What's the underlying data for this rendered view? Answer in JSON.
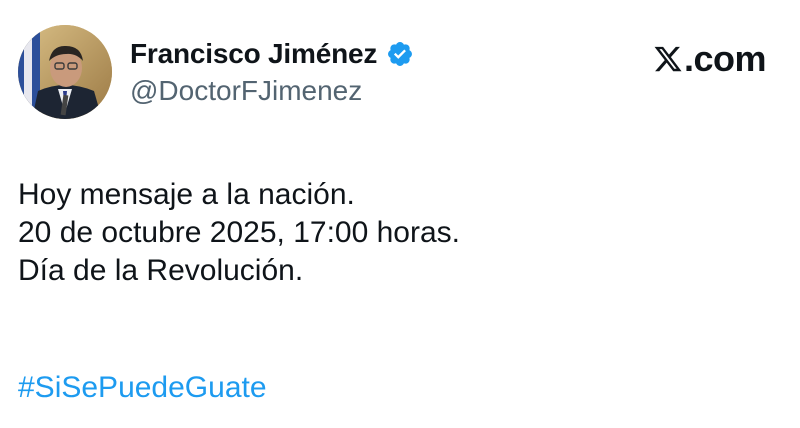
{
  "author": {
    "display_name": "Francisco Jiménez",
    "handle": "@DoctorFJimenez",
    "verified_badge_icon": "verified-badge-icon",
    "verified_badge_color": "#1d9bf0"
  },
  "brand": {
    "logo_icon": "x-logo-icon",
    "text": ".com"
  },
  "tweet": {
    "lines": [
      "Hoy mensaje a la nación.",
      "20 de octubre 2025, 17:00 horas.",
      "Día de la Revolución."
    ],
    "hashtag": "#SiSePuedeGuate",
    "hashtag_color": "#1d9bf0"
  }
}
